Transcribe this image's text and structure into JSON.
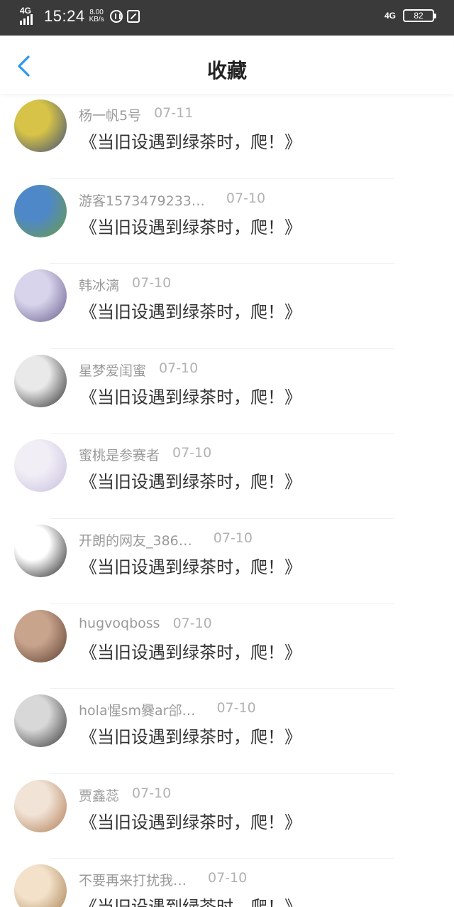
{
  "status_bar": {
    "network_left": "4G",
    "time": "15:24",
    "speed_value": "8.00",
    "speed_unit": "KB/s",
    "network_right": "4G",
    "battery": "82"
  },
  "header": {
    "title": "收藏",
    "back_icon": "chevron-left-icon",
    "accent": "#2b98f0"
  },
  "favorites": [
    {
      "user": "杨一帆5号",
      "date": "07-11",
      "text": "《当旧设遇到绿茶时，爬！》",
      "avatar_colors": [
        "#d6c347",
        "#3b4b7a"
      ]
    },
    {
      "user": "游客1573479233…",
      "date": "07-10",
      "text": "《当旧设遇到绿茶时，爬！》",
      "avatar_colors": [
        "#4f88c9",
        "#6c9c45"
      ]
    },
    {
      "user": "韩冰漓",
      "date": "07-10",
      "text": "《当旧设遇到绿茶时，爬！》",
      "avatar_colors": [
        "#d7d4ec",
        "#6a5c8a"
      ]
    },
    {
      "user": "星梦爱闺蜜",
      "date": "07-10",
      "text": "《当旧设遇到绿茶时，爬！》",
      "avatar_colors": [
        "#e9e9e9",
        "#2a2a2a"
      ]
    },
    {
      "user": "蜜桃是参赛者",
      "date": "07-10",
      "text": "《当旧设遇到绿茶时，爬！》",
      "avatar_colors": [
        "#f2eef6",
        "#c6bedd"
      ]
    },
    {
      "user": "开朗的网友_386…",
      "date": "07-10",
      "text": "《当旧设遇到绿茶时，爬！》",
      "avatar_colors": [
        "#ffffff",
        "#1e1e1e"
      ]
    },
    {
      "user": "hugvoqboss",
      "date": "07-10",
      "text": "《当旧设遇到绿茶时，爬！》",
      "avatar_colors": [
        "#c9a48d",
        "#5a3d2e"
      ]
    },
    {
      "user": "hola惺sm爨ar郃…",
      "date": "07-10",
      "text": "《当旧设遇到绿茶时，爬！》",
      "avatar_colors": [
        "#d8d8d8",
        "#333333"
      ]
    },
    {
      "user": "贾鑫蕊",
      "date": "07-10",
      "text": "《当旧设遇到绿茶时，爬！》",
      "avatar_colors": [
        "#f1e3d6",
        "#b07a52"
      ]
    },
    {
      "user": "不要再来打扰我…",
      "date": "07-10",
      "text": "《当旧设遇到绿茶时，爬！》",
      "avatar_colors": [
        "#f3e1c9",
        "#a47c4e"
      ]
    }
  ]
}
